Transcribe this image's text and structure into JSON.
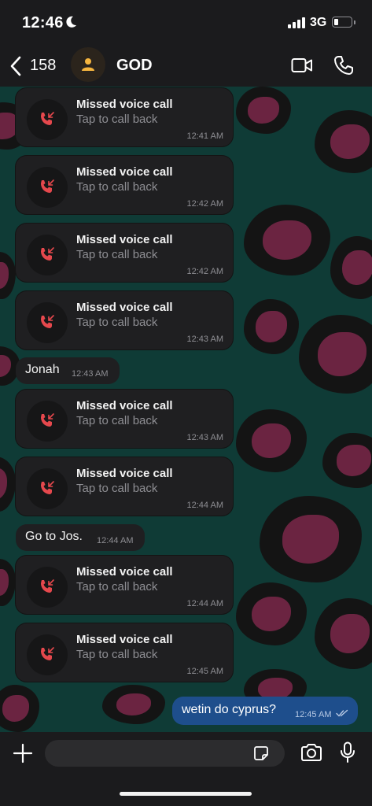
{
  "status": {
    "time": "12:46",
    "network": "3G"
  },
  "header": {
    "back_count": "158",
    "contact_name": "GOD"
  },
  "messages": [
    {
      "kind": "call",
      "title": "Missed voice call",
      "subtitle": "Tap to call back",
      "time": "12:41 AM"
    },
    {
      "kind": "call",
      "title": "Missed voice call",
      "subtitle": "Tap to call back",
      "time": "12:42 AM"
    },
    {
      "kind": "call",
      "title": "Missed voice call",
      "subtitle": "Tap to call back",
      "time": "12:42 AM"
    },
    {
      "kind": "call",
      "title": "Missed voice call",
      "subtitle": "Tap to call back",
      "time": "12:43 AM"
    },
    {
      "kind": "text_in",
      "text": "Jonah",
      "time": "12:43 AM"
    },
    {
      "kind": "call",
      "title": "Missed voice call",
      "subtitle": "Tap to call back",
      "time": "12:43 AM"
    },
    {
      "kind": "call",
      "title": "Missed voice call",
      "subtitle": "Tap to call back",
      "time": "12:44 AM"
    },
    {
      "kind": "text_in",
      "text": "Go to Jos.",
      "time": "12:44 AM"
    },
    {
      "kind": "call",
      "title": "Missed voice call",
      "subtitle": "Tap to call back",
      "time": "12:44 AM"
    },
    {
      "kind": "call",
      "title": "Missed voice call",
      "subtitle": "Tap to call back",
      "time": "12:45 AM"
    },
    {
      "kind": "text_out",
      "text": "wetin do cyprus?",
      "time": "12:45 AM",
      "status": "read"
    }
  ],
  "icons": {
    "back": "chevron-left-icon",
    "avatar": "person-icon",
    "video": "video-camera-icon",
    "call": "phone-icon",
    "missed_call": "missed-call-icon",
    "read_receipt": "double-check-icon",
    "add": "plus-icon",
    "sticker": "sticker-icon",
    "camera": "camera-icon",
    "mic": "microphone-icon"
  },
  "colors": {
    "missed_call": "#e5484d",
    "outgoing_bubble": "#1e4e8c",
    "incoming_bubble": "#1f1f21",
    "avatar_icon": "#f5b53f"
  }
}
